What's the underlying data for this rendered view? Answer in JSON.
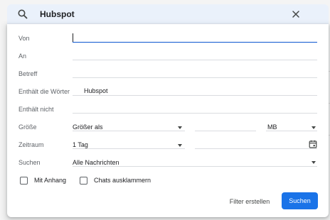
{
  "search": {
    "query": "Hubspot",
    "search_icon": "search-icon",
    "close_icon": "close-icon"
  },
  "filters": {
    "von": {
      "label": "Von",
      "value": ""
    },
    "an": {
      "label": "An",
      "value": ""
    },
    "betreff": {
      "label": "Betreff",
      "value": ""
    },
    "enthaelt_woerter": {
      "label": "Enthält die Wörter",
      "value": "Hubspot"
    },
    "enthaelt_nicht": {
      "label": "Enthält nicht",
      "value": ""
    },
    "groesse": {
      "label": "Größe",
      "comparator": "Größer als",
      "amount": "",
      "unit": "MB"
    },
    "zeitraum": {
      "label": "Zeitraum",
      "range": "1 Tag",
      "date": "",
      "calendar_icon": "calendar-icon"
    },
    "suchen": {
      "label": "Suchen",
      "scope": "Alle Nachrichten"
    }
  },
  "checkboxes": {
    "mit_anhang": {
      "label": "Mit Anhang",
      "checked": false
    },
    "chats": {
      "label": "Chats ausklammern",
      "checked": false
    }
  },
  "actions": {
    "filter_erstellen": "Filter erstellen",
    "suchen": "Suchen"
  },
  "colors": {
    "accent": "#1a73e8",
    "search_bar_bg": "#eaf1fb",
    "focus_underline": "#0b57d0"
  }
}
